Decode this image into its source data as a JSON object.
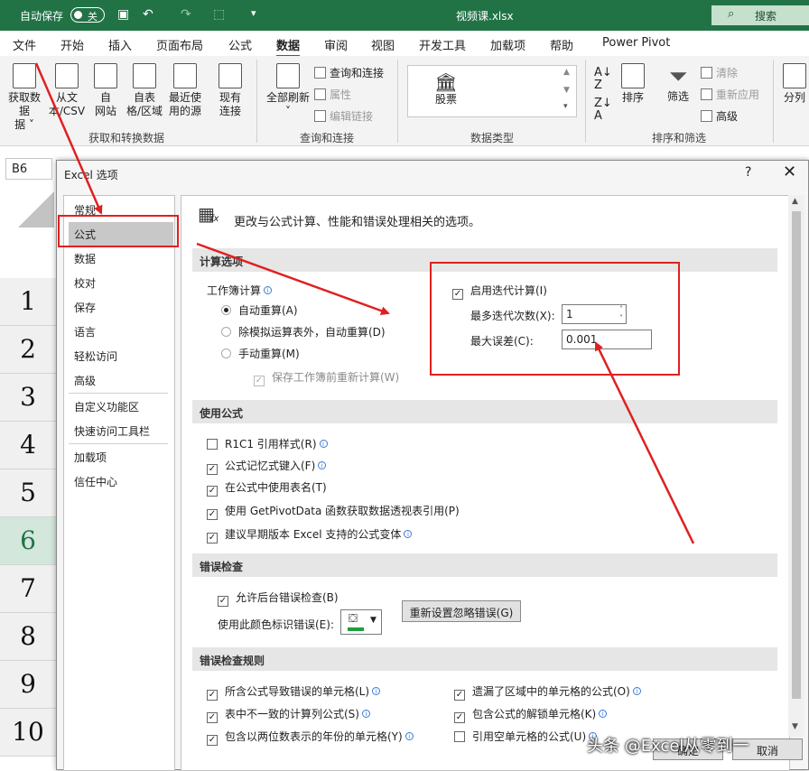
{
  "titlebar": {
    "autosave_label": "自动保存",
    "autosave_state": "关",
    "filename": "视频课.xlsx",
    "search_label": "搜索"
  },
  "tabs": [
    "文件",
    "开始",
    "插入",
    "页面布局",
    "公式",
    "数据",
    "审阅",
    "视图",
    "开发工具",
    "加载项",
    "帮助",
    "Power Pivot"
  ],
  "active_tab": "数据",
  "ribbon": {
    "get_data": "获取数据",
    "get_data_2": "据 ˅",
    "from_text": "从文",
    "from_text_2": "本/CSV",
    "from_web": "自",
    "from_web_2": "网站",
    "from_table": "自表",
    "from_table_2": "格/区域",
    "recent_sources": "最近使",
    "recent_sources_2": "用的源",
    "existing": "现有",
    "existing_2": "连接",
    "group_get": "获取和转换数据",
    "refresh_all": "全部刷新",
    "queries_connections": "查询和连接",
    "properties": "属性",
    "edit_links": "编辑链接",
    "group_queries": "查询和连接",
    "stocks": "股票",
    "group_datatypes": "数据类型",
    "sort": "排序",
    "filter": "筛选",
    "clear": "清除",
    "reapply": "重新应用",
    "advanced": "高级",
    "group_sortfilter": "排序和筛选",
    "split": "分列"
  },
  "namebox": "B6",
  "rows": [
    "1",
    "2",
    "3",
    "4",
    "5",
    "6",
    "7",
    "8",
    "9",
    "10"
  ],
  "selected_row": "6",
  "dialog": {
    "title": "Excel 选项",
    "help": "?",
    "close": "✕",
    "nav": [
      "常规",
      "公式",
      "数据",
      "校对",
      "保存",
      "语言",
      "轻松访问",
      "高级",
      "自定义功能区",
      "快速访问工具栏",
      "加载项",
      "信任中心"
    ],
    "nav_selected": "公式",
    "intro": "更改与公式计算、性能和错误处理相关的选项。",
    "calc": {
      "header": "计算选项",
      "workbook_calc": "工作簿计算",
      "auto": "自动重算(A)",
      "auto_except": "除模拟运算表外，自动重算(D)",
      "manual": "手动重算(M)",
      "recalc_before_save": "保存工作簿前重新计算(W)",
      "enable_iter": "启用迭代计算(I)",
      "max_iter_label": "最多迭代次数(X):",
      "max_iter_value": "1",
      "max_change_label": "最大误差(C):",
      "max_change_value": "0.001"
    },
    "formulas": {
      "header": "使用公式",
      "r1c1": "R1C1 引用样式(R)",
      "autocomplete": "公式记忆式键入(F)",
      "table_names": "在公式中使用表名(T)",
      "getpivot": "使用 GetPivotData 函数获取数据透视表引用(P)",
      "legacy": "建议早期版本 Excel 支持的公式变体"
    },
    "errors": {
      "header": "错误检查",
      "background": "允许后台错误检查(B)",
      "color_label": "使用此颜色标识错误(E):",
      "reset_button": "重新设置忽略错误(G)"
    },
    "rules": {
      "header": "错误检查规则",
      "r1": "所含公式导致错误的单元格(L)",
      "r2": "表中不一致的计算列公式(S)",
      "r3": "包含以两位数表示的年份的单元格(Y)",
      "r4": "遗漏了区域中的单元格的公式(O)",
      "r5": "包含公式的解锁单元格(K)",
      "r6": "引用空单元格的公式(U)"
    },
    "ok": "确定",
    "cancel": "取消"
  },
  "watermark": "头条 @Excel从零到一",
  "annotation_color": "#e02020",
  "accent_color": "#217346"
}
